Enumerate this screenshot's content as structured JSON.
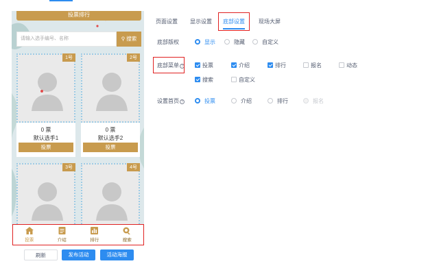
{
  "preview": {
    "banner": "投票排行",
    "search_placeholder": "请输入选手编号、名称",
    "search_button": "搜索",
    "cards": [
      {
        "num": "1号",
        "votes": "0 票",
        "name": "默认选手1",
        "vote_btn": "投票"
      },
      {
        "num": "2号",
        "votes": "0 票",
        "name": "默认选手2",
        "vote_btn": "投票"
      },
      {
        "num": "3号"
      },
      {
        "num": "4号"
      }
    ],
    "bottom_nav": [
      {
        "label": "投票",
        "icon": "home-icon"
      },
      {
        "label": "介绍",
        "icon": "document-icon"
      },
      {
        "label": "排行",
        "icon": "bar-chart-icon"
      },
      {
        "label": "搜索",
        "icon": "search-icon"
      }
    ],
    "actions": {
      "refresh": "刷新",
      "publish": "发布活动",
      "poster": "活动海报"
    }
  },
  "tabs": [
    "页面设置",
    "显示设置",
    "底部设置",
    "现场大屏"
  ],
  "active_tab": "底部设置",
  "settings": {
    "copyright": {
      "label": "底部版权",
      "options": [
        "显示",
        "隐藏",
        "自定义"
      ],
      "selected": "显示"
    },
    "menu": {
      "label": "底部菜单",
      "items": [
        {
          "label": "投票",
          "checked": true
        },
        {
          "label": "介绍",
          "checked": true
        },
        {
          "label": "排行",
          "checked": true
        },
        {
          "label": "报名",
          "checked": false
        },
        {
          "label": "动态",
          "checked": false
        },
        {
          "label": "搜索",
          "checked": true
        },
        {
          "label": "自定义",
          "checked": false
        }
      ]
    },
    "homepage": {
      "label": "设置首页",
      "options": [
        "投票",
        "介绍",
        "排行",
        "报名"
      ],
      "selected": "投票",
      "disabled": [
        "报名"
      ]
    }
  },
  "colors": {
    "accent": "#2d8cf0",
    "gold": "#c89b4e",
    "highlight": "#e02020"
  }
}
